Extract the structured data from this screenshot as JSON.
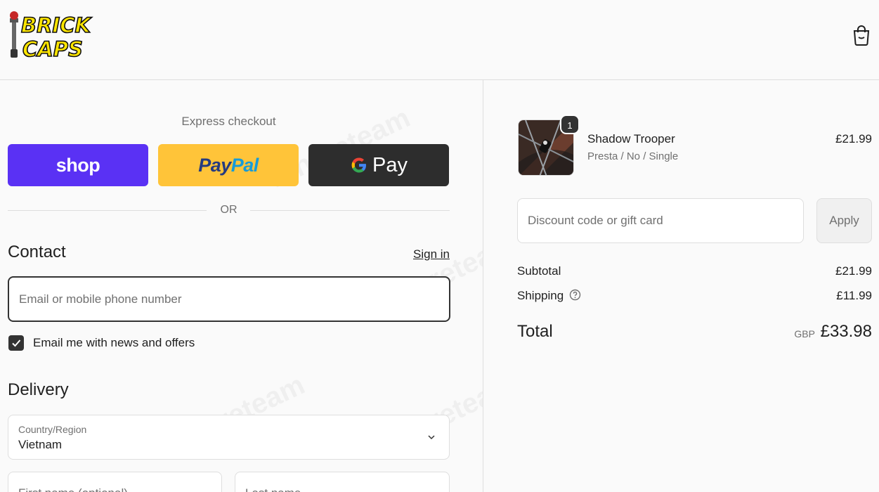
{
  "header": {
    "logo_text_top": "BRICK",
    "logo_text_bottom": "CAPS",
    "cart_icon": "shopping-bag-icon"
  },
  "express": {
    "title": "Express checkout",
    "shop_label": "shop",
    "paypal_label_a": "Pay",
    "paypal_label_b": "Pal",
    "gpay_label": "Pay",
    "or_label": "OR",
    "colors": {
      "shop": "#5a31f4",
      "paypal": "#ffc439",
      "gpay": "#2d2d2d"
    }
  },
  "contact": {
    "heading": "Contact",
    "sign_in": "Sign in",
    "email_placeholder": "Email or mobile phone number",
    "news_label": "Email me with news and offers",
    "news_checked": true
  },
  "delivery": {
    "heading": "Delivery",
    "country_label": "Country/Region",
    "country_value": "Vietnam",
    "first_name_placeholder": "First name (optional)",
    "last_name_placeholder": "Last name"
  },
  "order": {
    "item": {
      "name": "Shadow Trooper",
      "variant": "Presta / No / Single",
      "price": "£21.99",
      "quantity": "1"
    },
    "discount_placeholder": "Discount code or gift card",
    "apply_label": "Apply",
    "subtotal_label": "Subtotal",
    "subtotal_value": "£21.99",
    "shipping_label": "Shipping",
    "shipping_value": "£11.99",
    "total_label": "Total",
    "total_currency": "GBP",
    "total_value": "£33.98"
  },
  "watermark": "Tenereteam"
}
